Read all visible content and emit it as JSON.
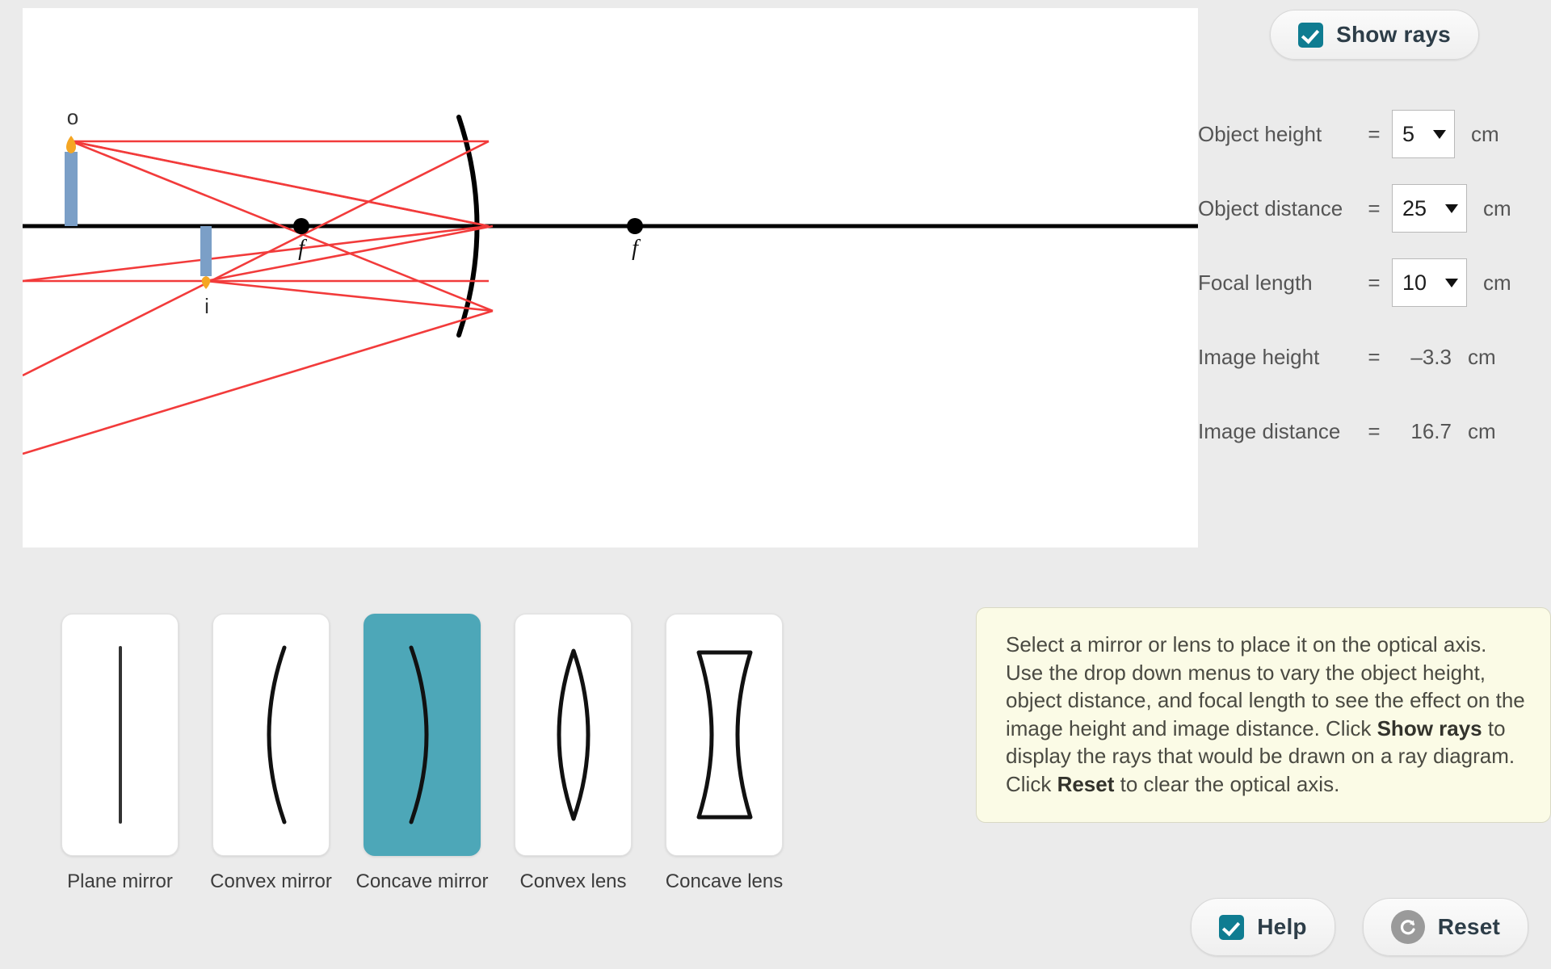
{
  "show_rays": {
    "label": "Show rays",
    "checked": true,
    "icon": "checkbox-checked-icon"
  },
  "parameters": [
    {
      "name": "Object height",
      "eq": "=",
      "value": "5",
      "unit": "cm",
      "type": "select"
    },
    {
      "name": "Object distance",
      "eq": "=",
      "value": "25",
      "unit": "cm",
      "type": "select"
    },
    {
      "name": "Focal length",
      "eq": "=",
      "value": "10",
      "unit": "cm",
      "type": "select"
    }
  ],
  "results": [
    {
      "name": "Image height",
      "eq": "=",
      "value": "–3.3",
      "unit": "cm"
    },
    {
      "name": "Image distance",
      "eq": "=",
      "value": "16.7",
      "unit": "cm"
    }
  ],
  "tools": [
    {
      "label": "Plane mirror",
      "icon": "plane-mirror-icon",
      "selected": false
    },
    {
      "label": "Convex mirror",
      "icon": "convex-mirror-icon",
      "selected": false
    },
    {
      "label": "Concave mirror",
      "icon": "concave-mirror-icon",
      "selected": true
    },
    {
      "label": "Convex lens",
      "icon": "convex-lens-icon",
      "selected": false
    },
    {
      "label": "Concave lens",
      "icon": "concave-lens-icon",
      "selected": false
    }
  ],
  "instruction": {
    "part1": "Select a mirror or lens to place it on the optical axis. Use the drop down menus to vary the object height, object distance, and focal length to see the effect on the image height and image distance. Click ",
    "bold1": "Show rays",
    "part2": " to display the rays that would be drawn on a ray diagram. Click ",
    "bold2": "Reset",
    "part3": " to clear the optical axis."
  },
  "buttons": {
    "help": {
      "label": "Help",
      "icon": "checkbox-checked-icon"
    },
    "reset": {
      "label": "Reset",
      "icon": "undo-arrow-icon"
    }
  },
  "diagram": {
    "object_label": "o",
    "image_label": "i",
    "focal_label_left": "f",
    "focal_label_right": "f",
    "ray_color": "#f23b3b",
    "axis_color": "#000000",
    "candle_color": "#7b9fc7",
    "flame_color": "#f5a623",
    "mirror_color": "#000000"
  },
  "colors": {
    "accent_teal": "#0f7c91",
    "selected_card": "#4da7b8",
    "page_background": "#ebebeb",
    "canvas_background": "#ffffff",
    "instruction_background": "#fbfbe6"
  }
}
